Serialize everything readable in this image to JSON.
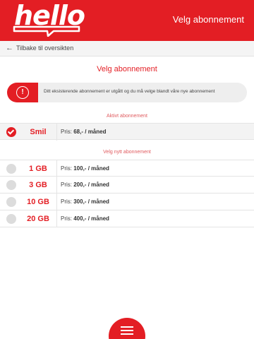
{
  "header": {
    "logo_text": "hello",
    "title": "Velg abonnement"
  },
  "backbar": {
    "label": "Tilbake til oversikten",
    "icon": "back-arrow-icon"
  },
  "page_title": "Velg abonnement",
  "info": {
    "icon": "info-icon",
    "text": "Ditt eksisterende abonnement er utgått og du må velge blandt våre nye abonnement"
  },
  "active_section": {
    "label": "Aktivt abonnement",
    "plan": {
      "name": "Smil",
      "price_prefix": "Pris:",
      "price": "68,- / måned",
      "selected": true
    }
  },
  "new_section": {
    "label": "Velg nytt abonnement",
    "plans": [
      {
        "name": "1 GB",
        "price_prefix": "Pris:",
        "price": "100,- / måned",
        "selected": false
      },
      {
        "name": "3 GB",
        "price_prefix": "Pris:",
        "price": "200,- / måned",
        "selected": false
      },
      {
        "name": "10 GB",
        "price_prefix": "Pris:",
        "price": "300,- / måned",
        "selected": false
      },
      {
        "name": "20 GB",
        "price_prefix": "Pris:",
        "price": "400,- / måned",
        "selected": false
      }
    ]
  },
  "menu_button": {
    "icon": "hamburger-menu-icon"
  },
  "colors": {
    "brand": "#e31e24",
    "background": "#ffffff",
    "row_active": "#f3f3f3"
  }
}
